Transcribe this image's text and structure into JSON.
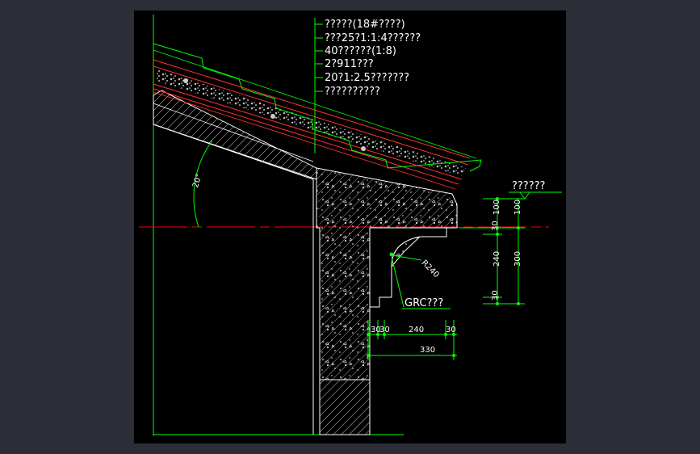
{
  "colors": {
    "background": "#2b2d37",
    "viewport": "#000000",
    "section_lines": "#ffffff",
    "leader_lines": "#00ff00",
    "roof_layers": "#ff3030",
    "centerline": "#ff0000"
  },
  "callouts": {
    "roof_layers": [
      "?????(18#????)",
      "???25?1:1:4??????",
      "40??????(1:8)",
      "2?911???",
      "20?1:2.5???????",
      "??????????"
    ],
    "ridge_label": "??????",
    "grc_label": "GRC???",
    "radius_label": "R240",
    "angle_label": "20°"
  },
  "dimensions": {
    "vertical": {
      "d100_a": "100",
      "d100_b": "100",
      "d30_a": "30",
      "d240": "240",
      "d300": "300",
      "d30_b": "30"
    },
    "horizontal": {
      "d30_a": "30",
      "d30_b": "30",
      "d240": "240",
      "d30_c": "30",
      "d330": "330"
    }
  }
}
